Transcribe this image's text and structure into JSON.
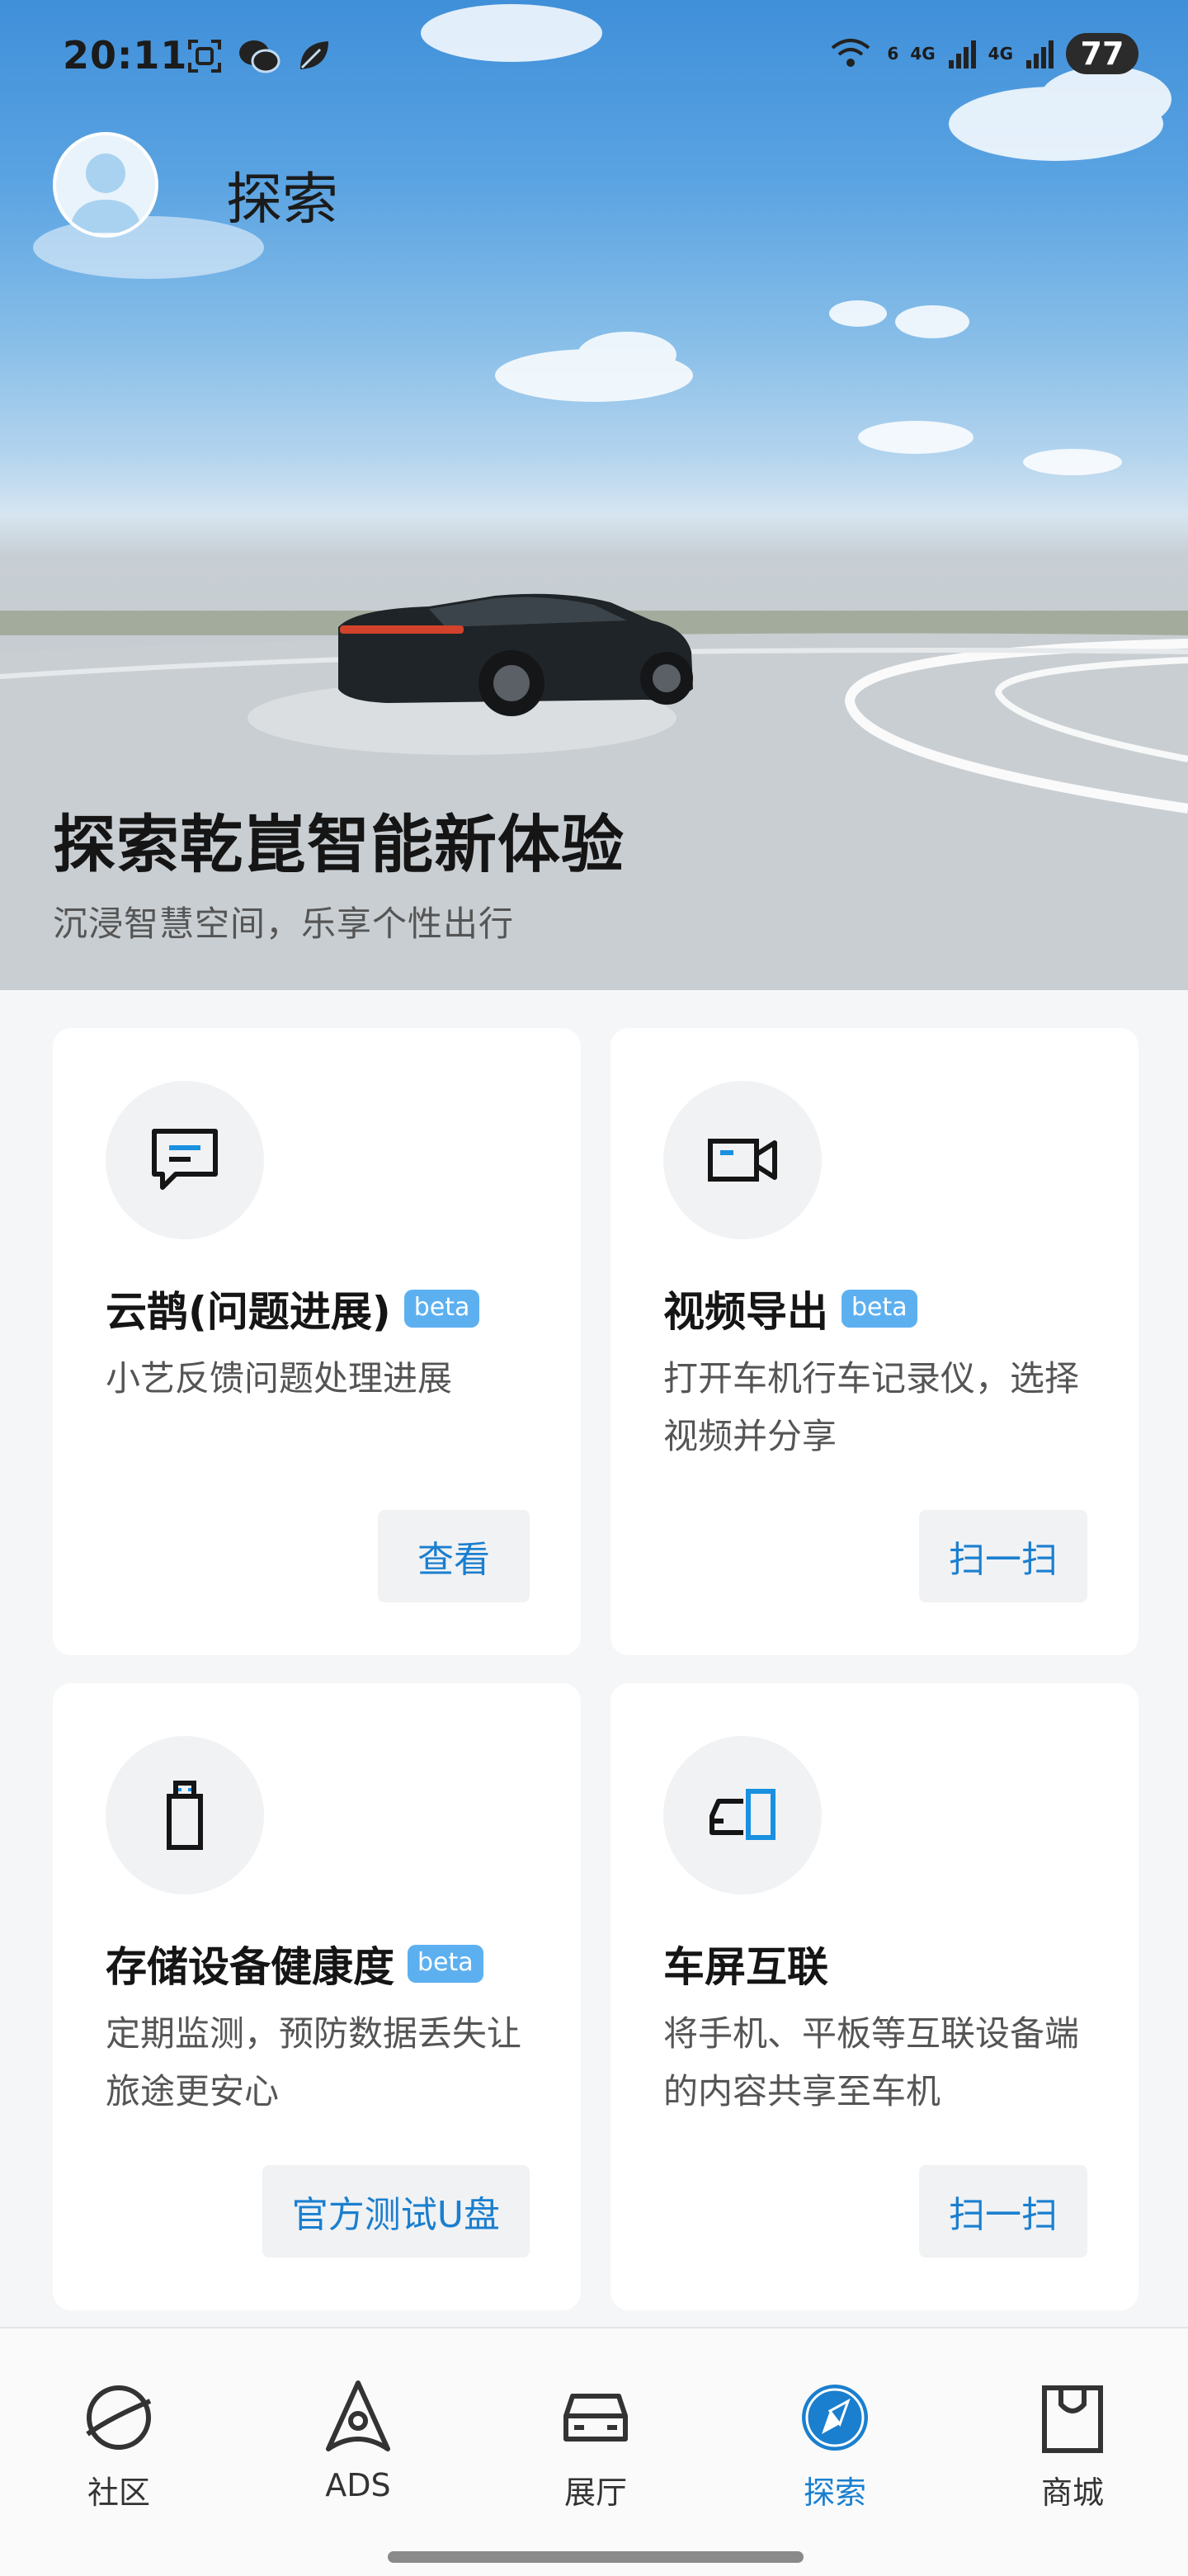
{
  "status_bar": {
    "time": "20:11",
    "left_icons": [
      "screenshot-icon",
      "wechat-icon",
      "leaf-icon"
    ],
    "network_labels": [
      "6",
      "4G",
      "4G"
    ],
    "battery": "77"
  },
  "header": {
    "title": "探索"
  },
  "hero": {
    "title": "探索乾崑智能新体验",
    "subtitle": "沉浸智慧空间，乐享个性出行"
  },
  "cards": [
    {
      "icon": "message-icon",
      "title": "云鹊(问题进展)",
      "badge": "beta",
      "desc": "小艺反馈问题处理进展",
      "action": "查看"
    },
    {
      "icon": "video-camera-icon",
      "title": "视频导出",
      "badge": "beta",
      "desc": "打开车机行车记录仪，选择视频并分享",
      "action": "扫一扫"
    },
    {
      "icon": "usb-drive-icon",
      "title": "存储设备健康度",
      "badge": "beta",
      "desc": "定期监测，预防数据丢失让旅途更安心",
      "action": "官方测试U盘"
    },
    {
      "icon": "car-screen-icon",
      "title": "车屏互联",
      "badge": "",
      "desc": "将手机、平板等互联设备端的内容共享至车机",
      "action": "扫一扫"
    }
  ],
  "bottom_nav": {
    "items": [
      {
        "label": "社区",
        "icon": "planet-icon",
        "active": false
      },
      {
        "label": "ADS",
        "icon": "ads-icon",
        "active": false
      },
      {
        "label": "展厅",
        "icon": "car-icon",
        "active": false
      },
      {
        "label": "探索",
        "icon": "compass-icon",
        "active": true
      },
      {
        "label": "商城",
        "icon": "shopping-bag-icon",
        "active": false
      }
    ]
  },
  "colors": {
    "accent": "#1a7fcf",
    "beta_badge": "#5db0f0",
    "sky": "#4a95dc"
  }
}
